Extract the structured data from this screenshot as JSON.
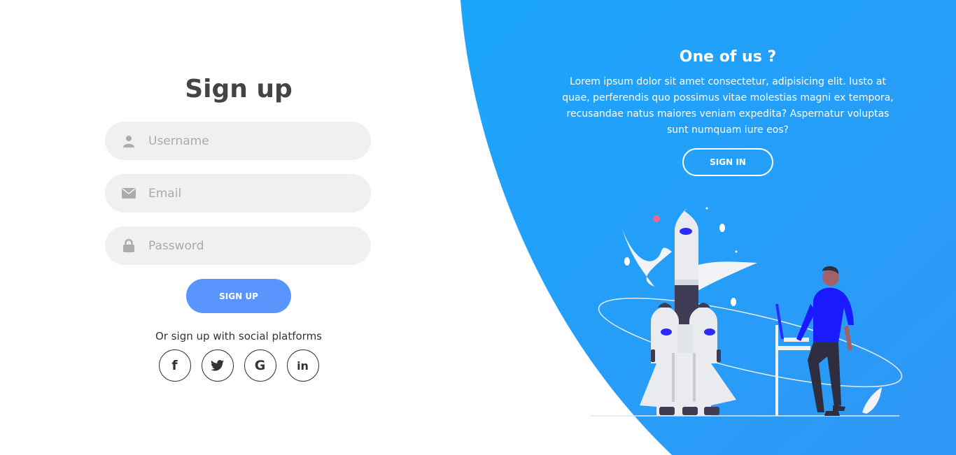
{
  "signup": {
    "title": "Sign up",
    "fields": {
      "username_placeholder": "Username",
      "email_placeholder": "Email",
      "password_placeholder": "Password"
    },
    "button_label": "SIGN UP",
    "social_text": "Or sign up with social platforms",
    "social": [
      {
        "name": "facebook",
        "glyph": "f"
      },
      {
        "name": "twitter",
        "glyph": "twitter-icon"
      },
      {
        "name": "google",
        "glyph": "G"
      },
      {
        "name": "linkedin",
        "glyph": "in"
      }
    ]
  },
  "panel": {
    "title": "One of us ?",
    "text": "Lorem ipsum dolor sit amet consectetur, adipisicing elit. Iusto at quae, perferendis quo possimus vitae molestias magni ex tempora, recusandae natus maiores veniam expedita? Aspernatur voluptas sunt numquam iure eos?",
    "button_label": "SIGN IN"
  },
  "colors": {
    "accent": "#5995fd",
    "panel_start": "#1ba6fb",
    "panel_end": "#2f97f6",
    "title": "#444444",
    "field_bg": "#f0f0f0"
  }
}
